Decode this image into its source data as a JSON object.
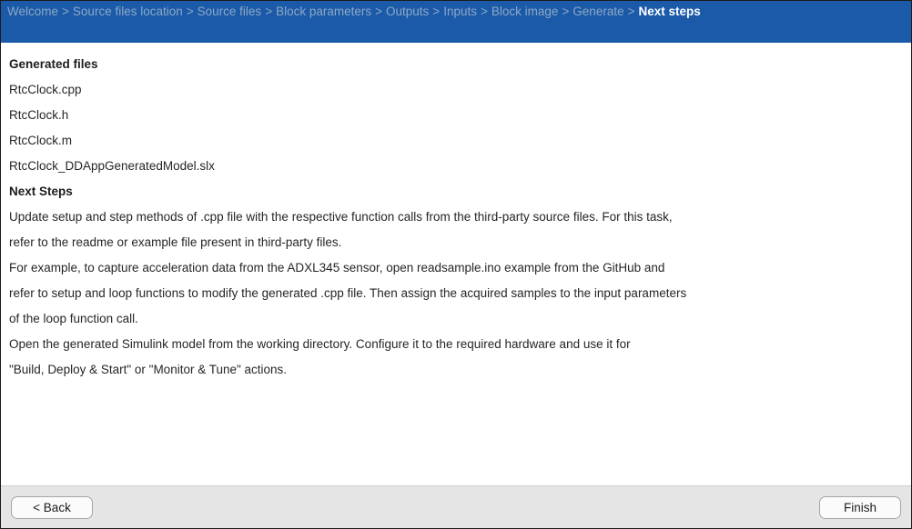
{
  "header": {
    "breadcrumb_separator": ">",
    "breadcrumb": [
      {
        "label": "Welcome",
        "active": false
      },
      {
        "label": "Source files location",
        "active": false
      },
      {
        "label": "Source files",
        "active": false
      },
      {
        "label": "Block parameters",
        "active": false
      },
      {
        "label": "Outputs",
        "active": false
      },
      {
        "label": "Inputs",
        "active": false
      },
      {
        "label": "Block image",
        "active": false
      },
      {
        "label": "Generate",
        "active": false
      },
      {
        "label": "Next steps",
        "active": true
      }
    ],
    "background_color": "#1a5aa8",
    "inactive_text_color": "#8ea8c6",
    "active_text_color": "#ffffff"
  },
  "main": {
    "lines": [
      {
        "text": "Generated files",
        "heading": true
      },
      {
        "text": "RtcClock.cpp",
        "heading": false
      },
      {
        "text": "RtcClock.h",
        "heading": false
      },
      {
        "text": "RtcClock.m",
        "heading": false
      },
      {
        "text": "RtcClock_DDAppGeneratedModel.slx",
        "heading": false
      },
      {
        "text": "Next Steps",
        "heading": true
      },
      {
        "text": "Update setup and step methods of .cpp file with the respective function calls from the third-party source files. For this task,",
        "heading": false
      },
      {
        "text": "refer to the readme or example file present in third-party files.",
        "heading": false
      },
      {
        "text": "For example, to capture acceleration data from the ADXL345 sensor, open readsample.ino example from the GitHub and",
        "heading": false
      },
      {
        "text": "refer to setup and loop functions to modify the generated .cpp file. Then assign the acquired samples to the input parameters",
        "heading": false
      },
      {
        "text": "of the loop function call.",
        "heading": false
      },
      {
        "text": "Open the generated Simulink model from the working directory. Configure it to the required hardware and use it for",
        "heading": false
      },
      {
        "text": "\"Build, Deploy & Start\" or \"Monitor & Tune\" actions.",
        "heading": false
      }
    ]
  },
  "footer": {
    "back_label": "< Back",
    "finish_label": "Finish",
    "background_color": "#e5e5e5"
  }
}
